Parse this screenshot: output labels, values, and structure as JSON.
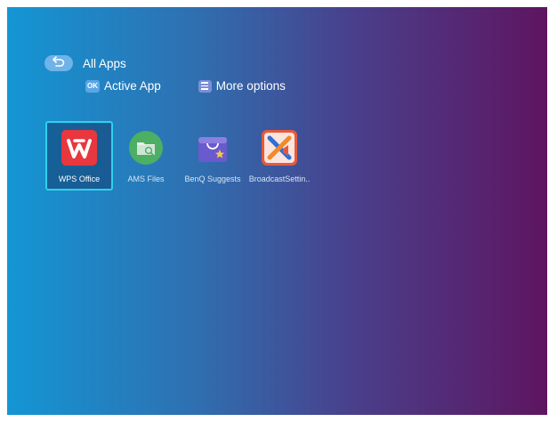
{
  "header": {
    "title": "All Apps",
    "back_icon": "back-arrow-icon"
  },
  "hints": [
    {
      "badge": "OK",
      "label": "Active App",
      "icon": "ok-key-icon"
    },
    {
      "badge": "",
      "label": "More options",
      "icon": "menu-key-icon"
    }
  ],
  "apps": [
    {
      "label": "WPS Office",
      "icon": "wps-office-icon",
      "selected": true,
      "color": "#e8373e"
    },
    {
      "label": "AMS Files",
      "icon": "ams-files-icon",
      "selected": false,
      "color": "#4caf64"
    },
    {
      "label": "BenQ Suggests",
      "icon": "benq-suggests-icon",
      "selected": false,
      "color": "#6a5acd"
    },
    {
      "label": "BroadcastSettin..",
      "icon": "broadcast-settings-icon",
      "selected": false,
      "color": "#e45a3c"
    }
  ],
  "colors": {
    "focus_border": "#2fd1ee",
    "gradient_start": "#1496d4",
    "gradient_end": "#5e1560"
  }
}
